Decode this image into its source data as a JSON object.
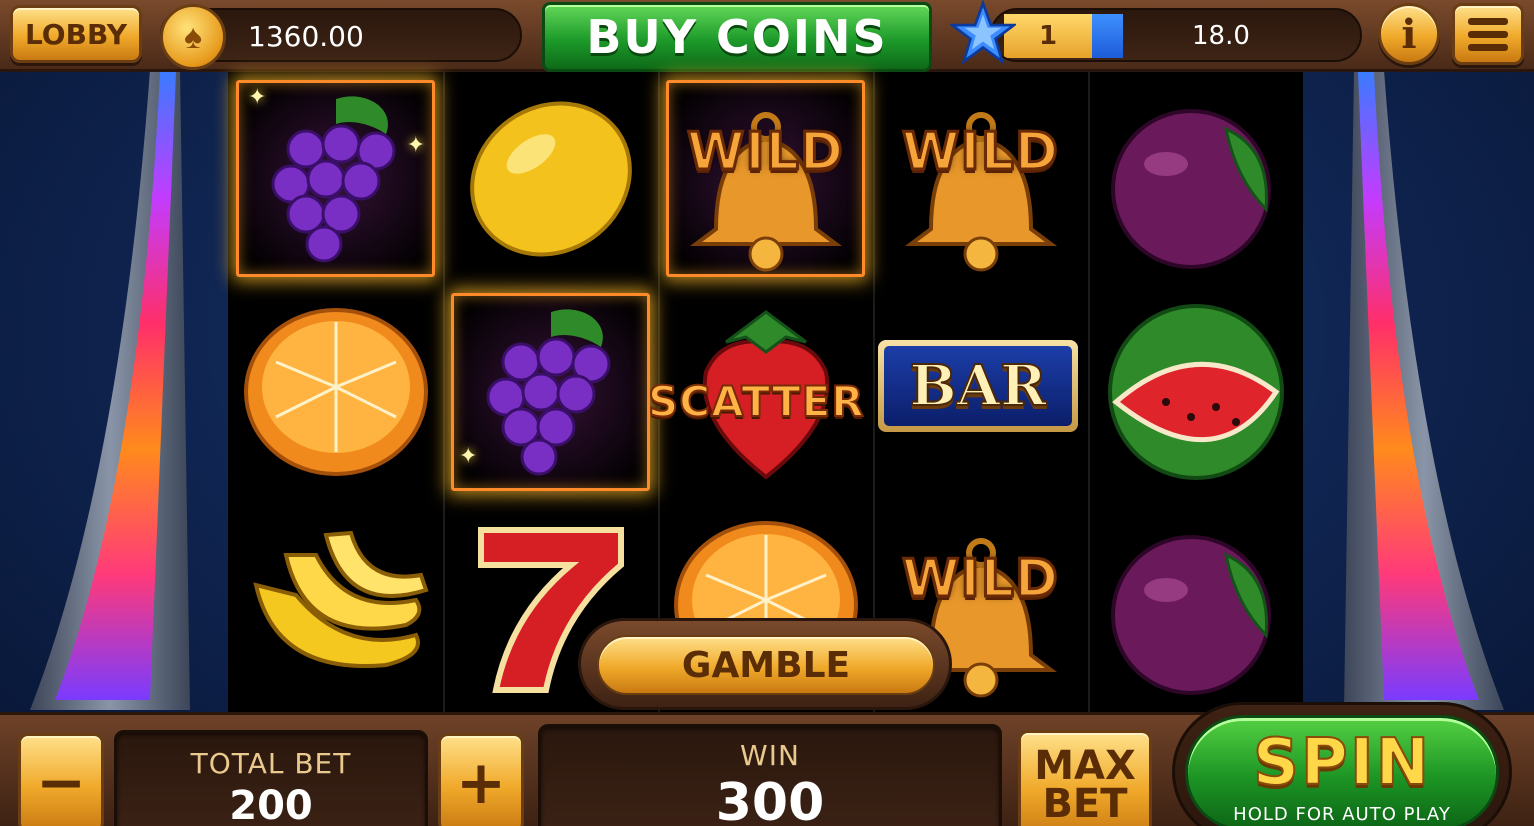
{
  "header": {
    "lobby_label": "LOBBY",
    "coin_balance": "1360.00",
    "buy_coins_label": "BUY COINS",
    "level": "1",
    "level_progress": 0.12,
    "xp_value": "18.0",
    "info_label": "i"
  },
  "reels": {
    "columns": 5,
    "rows": 3,
    "grid": [
      [
        "grapes",
        "lemon",
        "wild-bell",
        "wild-bell",
        "plum"
      ],
      [
        "orange",
        "grapes",
        "scatter-strawberry",
        "bar",
        "watermelon"
      ],
      [
        "banana",
        "seven",
        "orange",
        "wild-bell",
        "plum"
      ]
    ],
    "winning_cells": [
      [
        0,
        0
      ],
      [
        1,
        1
      ],
      [
        0,
        2
      ]
    ],
    "wild_label": "WILD",
    "scatter_label": "SCATTER",
    "bar_label": "BAR"
  },
  "footer": {
    "minus_label": "−",
    "total_bet_label": "TOTAL BET",
    "total_bet_value": "200",
    "plus_label": "+",
    "gamble_label": "GAMBLE",
    "win_label": "WIN",
    "win_value": "300",
    "max_bet_line1": "MAX",
    "max_bet_line2": "BET",
    "spin_label": "SPIN",
    "spin_sub": "HOLD FOR AUTO PLAY"
  },
  "colors": {
    "accent_gold": "#f0a92a",
    "buy_green": "#1d9a2a",
    "win_frame": "#ff8a2a",
    "background": "#0f2450"
  }
}
